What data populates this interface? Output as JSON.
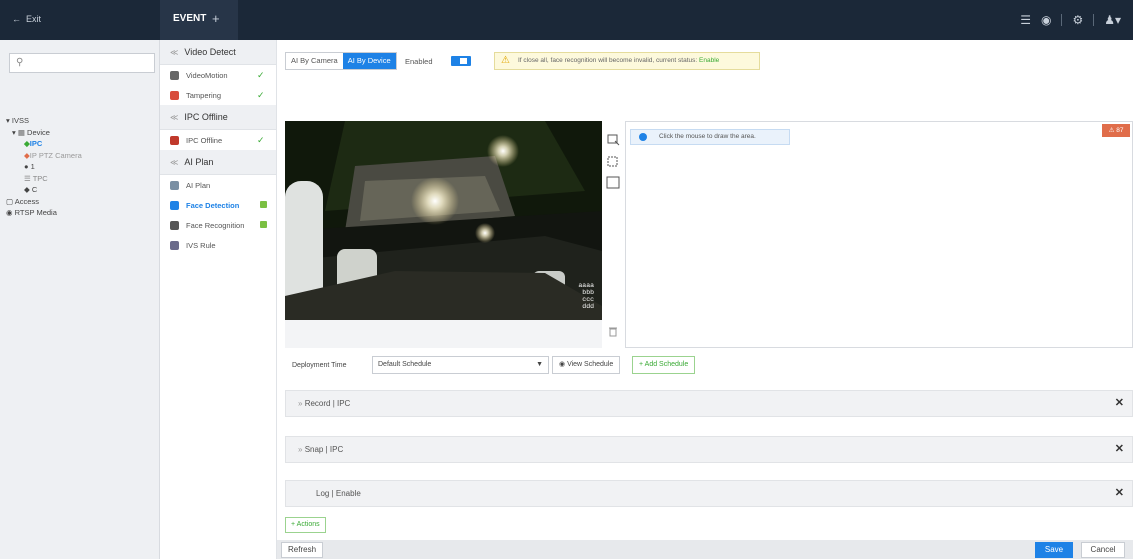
{
  "topbar": {
    "exit": "Exit",
    "tab": "EVENT",
    "add": "+"
  },
  "tree": {
    "root": "IVSS",
    "device": "Device",
    "ipc": "IPC",
    "ptz": "IP PTZ Camera",
    "one": "1",
    "tpc": "TPC",
    "c": "C",
    "access": "Access",
    "rtsp": "RTSP Media"
  },
  "mid": {
    "video_detect": "Video Detect",
    "video_motion": "VideoMotion",
    "tampering": "Tampering",
    "ipc_offline_h": "IPC Offline",
    "ipc_offline": "IPC Offline",
    "ai_plan_h": "AI Plan",
    "ai_plan": "AI Plan",
    "face_detection": "Face Detection",
    "face_recognition": "Face Recognition",
    "ivs_rule": "IVS Rule"
  },
  "main": {
    "tab_camera": "AI By Camera",
    "tab_device": "AI By Device",
    "enabled": "Enabled",
    "warning": "If close all, face recognition will become invalid, current status:",
    "warning_status": "Enable",
    "draw_tip": "Click the mouse to draw the area.",
    "badge": "87",
    "osd": [
      "aaaa",
      "bbb",
      "ccc",
      "ddd"
    ],
    "deploy_label": "Deployment Time",
    "schedule": "Default Schedule",
    "view_schedule": "View Schedule",
    "add_schedule": "Add Schedule",
    "record": "Record | IPC",
    "snap": "Snap | IPC",
    "log": "Log | Enable",
    "actions": "Actions",
    "refresh": "Refresh",
    "save": "Save",
    "cancel": "Cancel"
  },
  "colors": {
    "accent": "#1e82e6",
    "ok": "#3aaa35",
    "topbar": "#1b2838"
  }
}
